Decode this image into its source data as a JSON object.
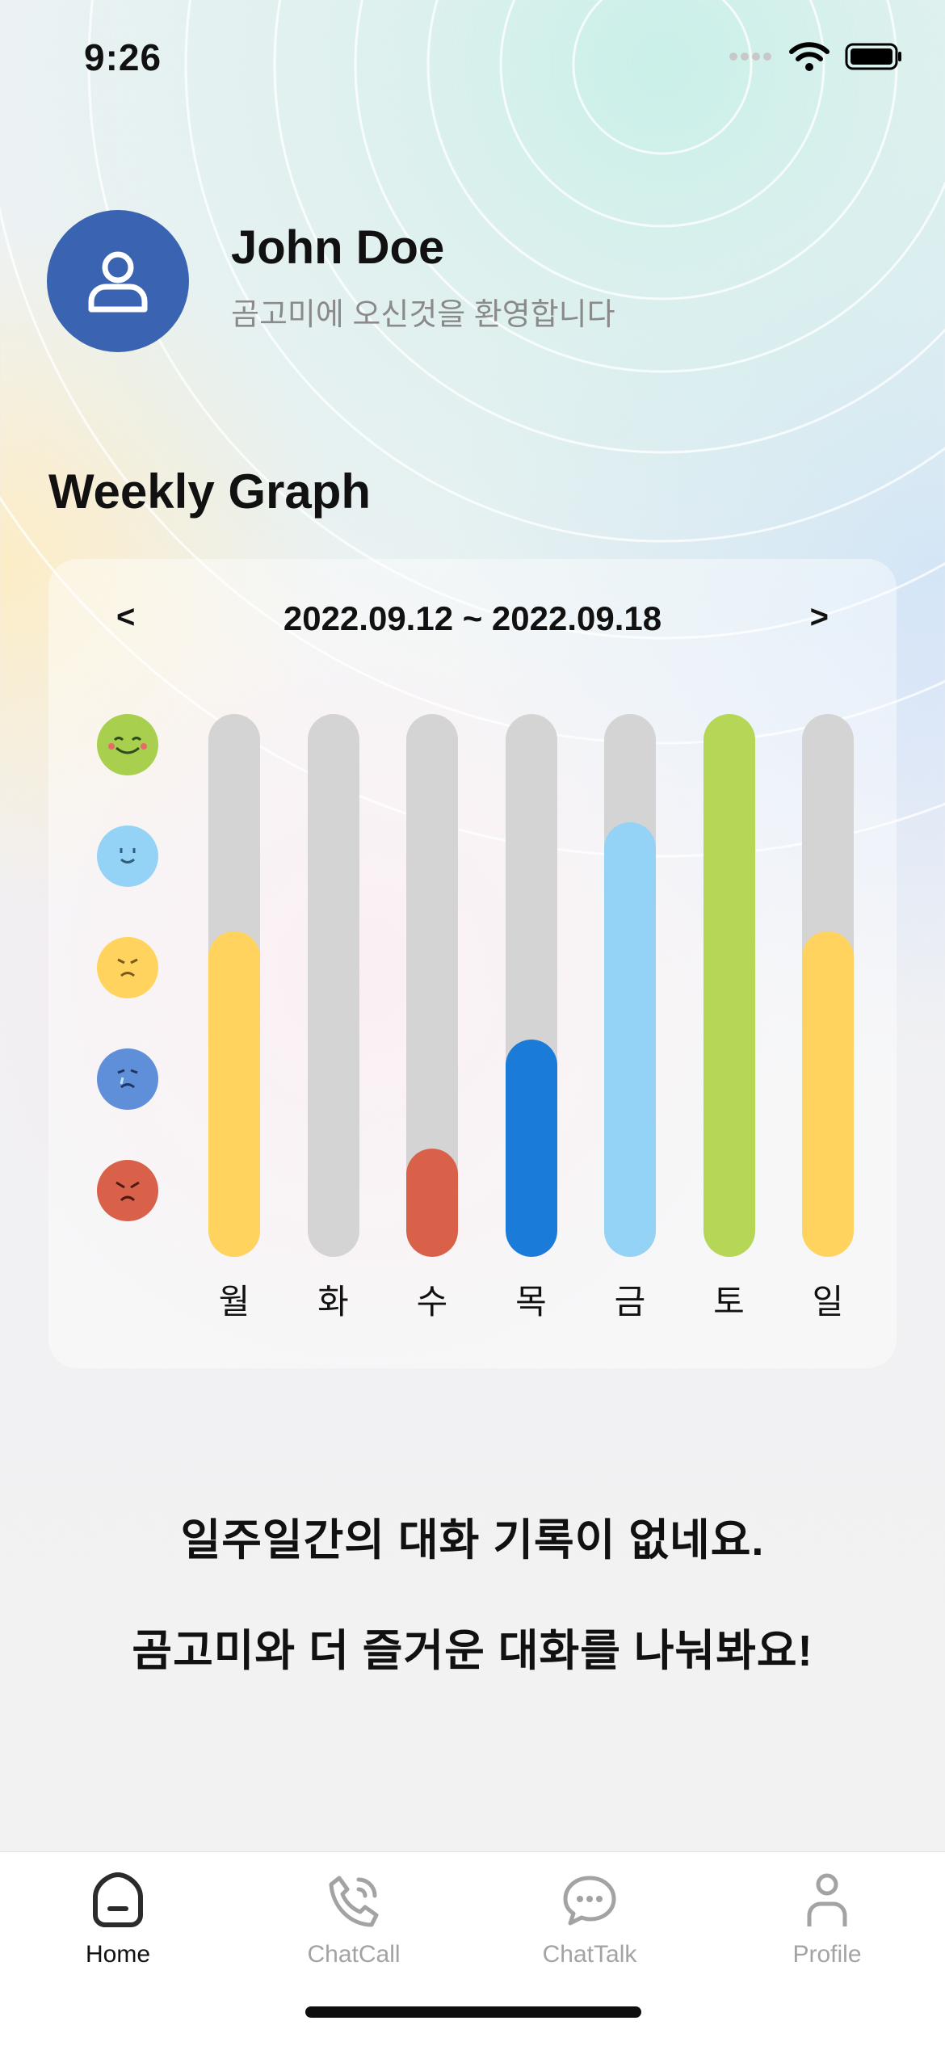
{
  "status_bar": {
    "time": "9:26"
  },
  "profile": {
    "name": "John Doe",
    "welcome": "곰고미에 오신것을 환영합니다"
  },
  "section_title": "Weekly Graph",
  "graph": {
    "prev_label": "<",
    "next_label": ">",
    "date_range": "2022.09.12 ~ 2022.09.18",
    "max_level": 5,
    "moods": [
      {
        "name": "happy-mood-icon",
        "color": "#a8cf4e"
      },
      {
        "name": "calm-mood-icon",
        "color": "#94d3f6"
      },
      {
        "name": "worried-mood-icon",
        "color": "#ffd35e"
      },
      {
        "name": "sad-mood-icon",
        "color": "#5f8fd8"
      },
      {
        "name": "angry-mood-icon",
        "color": "#d9614a"
      }
    ],
    "days": [
      {
        "label": "월",
        "level": 3,
        "color": "#ffd35e"
      },
      {
        "label": "화",
        "level": 0,
        "color": "#d4d4d4"
      },
      {
        "label": "수",
        "level": 1,
        "color": "#d9614a"
      },
      {
        "label": "목",
        "level": 2,
        "color": "#1b7bd8"
      },
      {
        "label": "금",
        "level": 4,
        "color": "#94d3f6"
      },
      {
        "label": "토",
        "level": 5,
        "color": "#b6d656"
      },
      {
        "label": "일",
        "level": 3,
        "color": "#ffd35e"
      }
    ]
  },
  "empty_message": {
    "line1": "일주일간의 대화 기록이 없네요.",
    "line2": "곰고미와 더 즐거운 대화를 나눠봐요!"
  },
  "tab_bar": {
    "tabs": [
      {
        "label": "Home",
        "icon": "home-icon",
        "active": true
      },
      {
        "label": "ChatCall",
        "icon": "phone-call-icon",
        "active": false
      },
      {
        "label": "ChatTalk",
        "icon": "chat-bubble-icon",
        "active": false
      },
      {
        "label": "Profile",
        "icon": "person-icon",
        "active": false
      }
    ]
  }
}
